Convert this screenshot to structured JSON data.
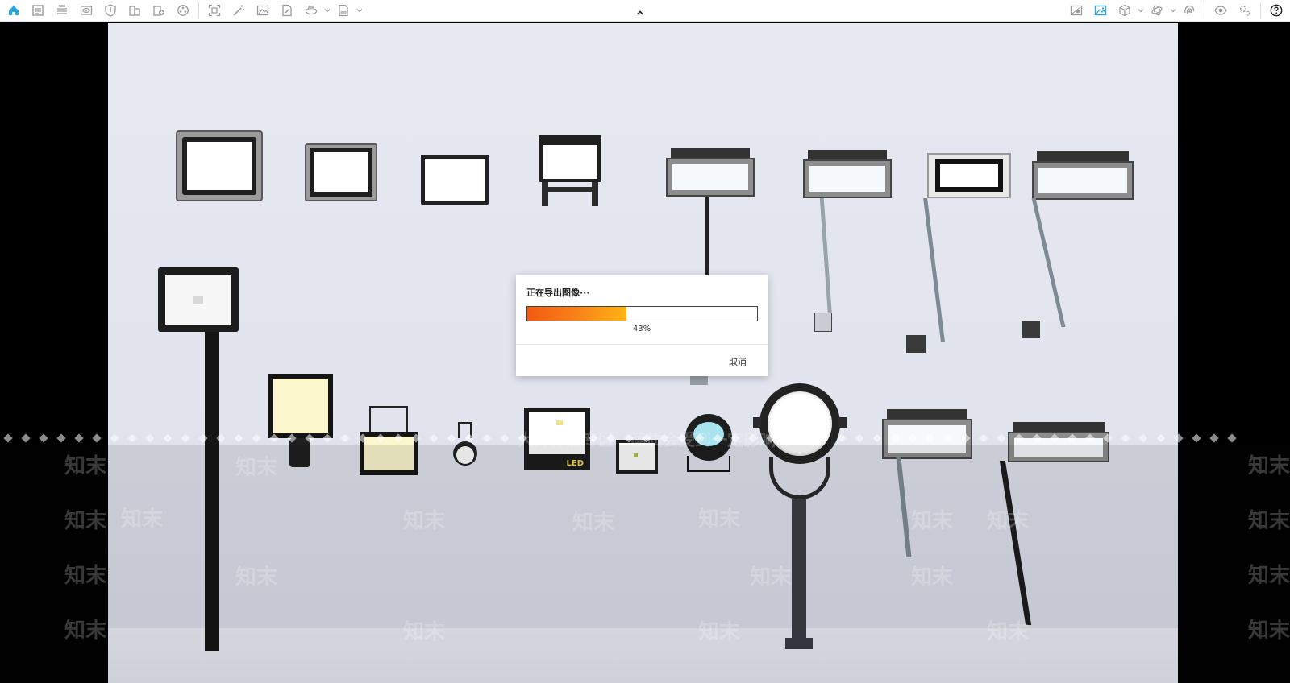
{
  "toolbar": {
    "left_icons": [
      "home-icon",
      "document-icon",
      "bim-list-icon",
      "eye-panel-icon",
      "shield-icon",
      "building-icon",
      "add-building-icon",
      "reel-icon",
      "scan-frame-icon",
      "magic-wand-icon",
      "image-icon",
      "file-edit-icon",
      "panorama-360-icon",
      "exe-file-icon"
    ],
    "right_icons": [
      "map-icon",
      "render-image-icon",
      "cube-icon",
      "layers-icon",
      "fingerprint-icon",
      "eye-icon",
      "settings-icon",
      "help-icon"
    ],
    "accent": "#2aa6e0"
  },
  "dialog": {
    "title": "正在导出图像···",
    "progress": 43,
    "progress_label": "43%",
    "cancel_label": "取消"
  },
  "viewport": {
    "fixtures_label": "LED"
  },
  "watermark": {
    "text": "知末",
    "row_text": "大师作品专区　画质会受到一定影响"
  }
}
